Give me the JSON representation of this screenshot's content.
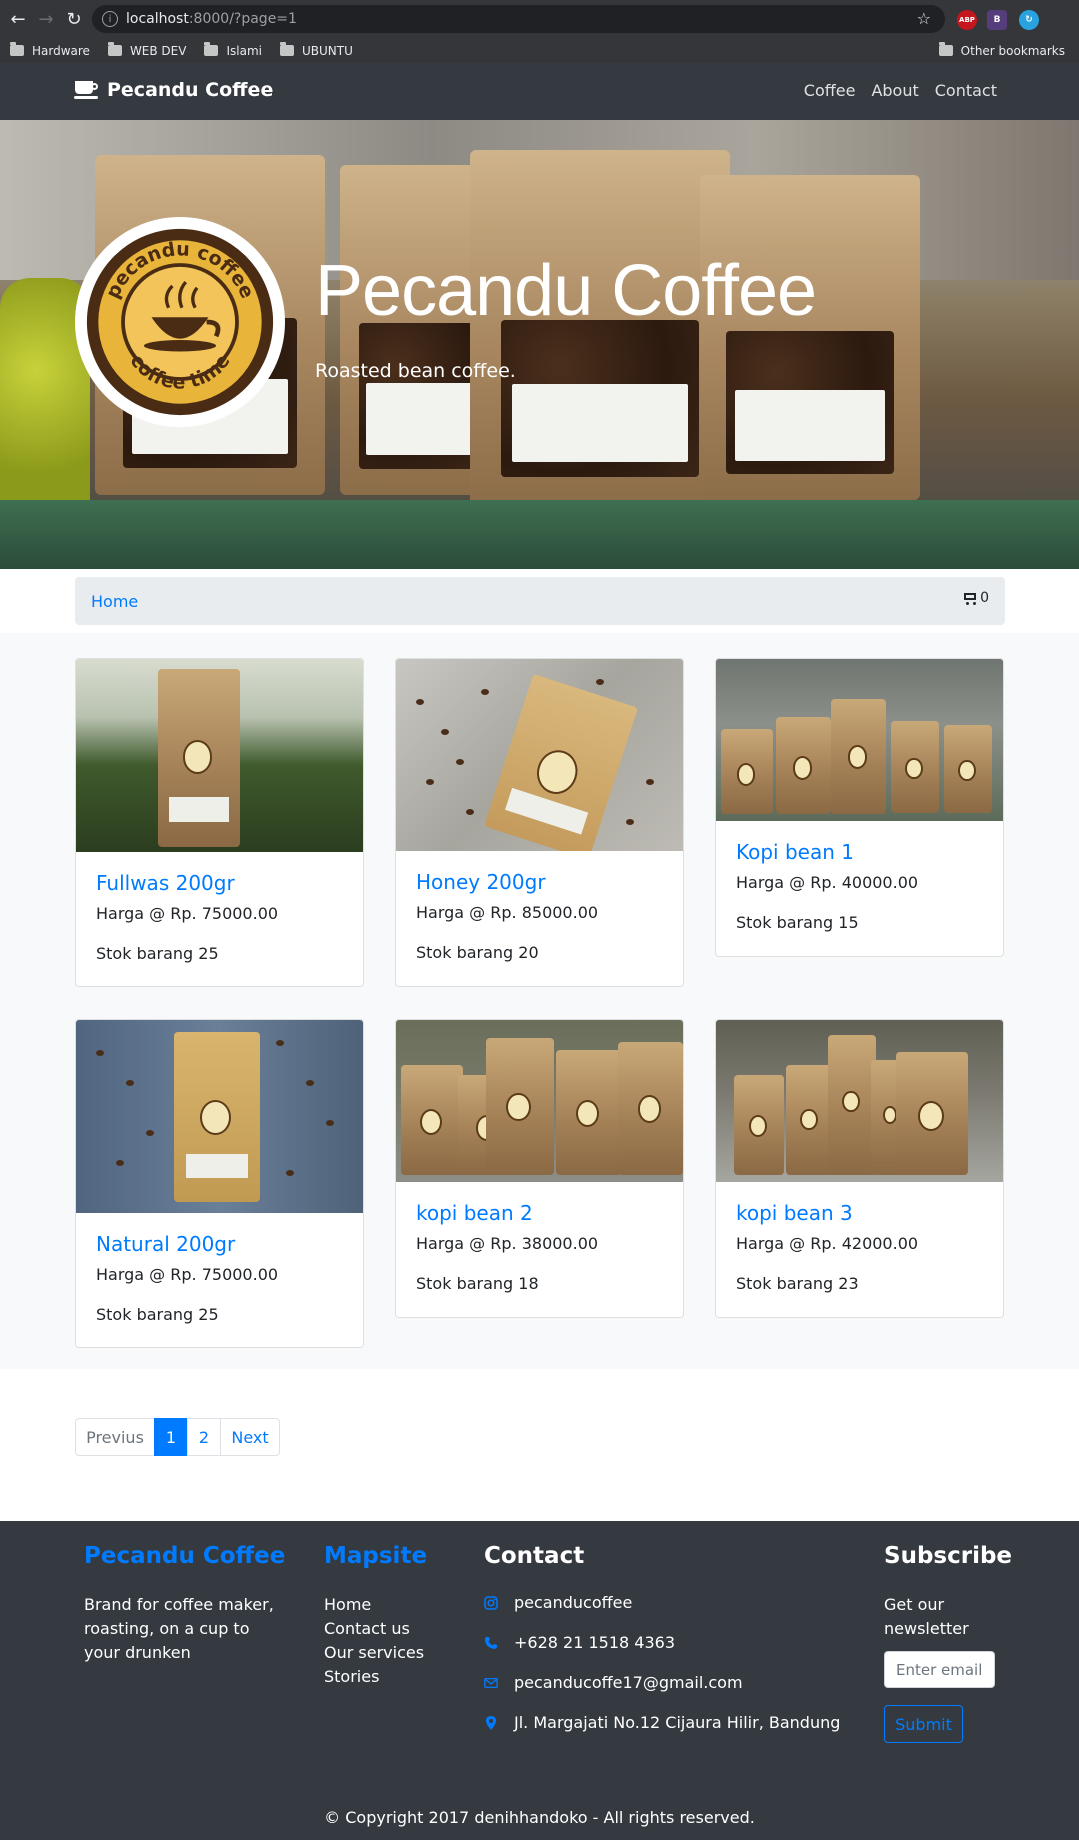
{
  "browser": {
    "url_host": "localhost",
    "url_path": ":8000/?page=1",
    "bookmarks": [
      "Hardware",
      "WEB DEV",
      "Islami",
      "UBUNTU"
    ],
    "other_bookmarks": "Other bookmarks",
    "ext_abp": "ABP",
    "ext_b": "B"
  },
  "navbar": {
    "brand": "Pecandu Coffee",
    "links": [
      "Coffee",
      "About",
      "Contact"
    ]
  },
  "hero": {
    "title": "Pecandu Coffee",
    "subtitle": "Roasted bean coffee.",
    "logo_top": "pecandu coffee",
    "logo_bottom": "coffee time"
  },
  "breadcrumb": {
    "home": "Home",
    "cart_count": "0"
  },
  "products": [
    {
      "name": "Fullwas 200gr",
      "price": "Harga @ Rp. 75000.00",
      "stock": "Stok barang 25"
    },
    {
      "name": "Honey 200gr",
      "price": "Harga @ Rp. 85000.00",
      "stock": "Stok barang 20"
    },
    {
      "name": "Kopi bean 1",
      "price": "Harga @ Rp. 40000.00",
      "stock": "Stok barang 15"
    },
    {
      "name": "Natural 200gr",
      "price": "Harga @ Rp. 75000.00",
      "stock": "Stok barang 25"
    },
    {
      "name": "kopi bean 2",
      "price": "Harga @ Rp. 38000.00",
      "stock": "Stok barang 18"
    },
    {
      "name": "kopi bean 3",
      "price": "Harga @ Rp. 42000.00",
      "stock": "Stok barang 23"
    }
  ],
  "pagination": {
    "prev": "Previus",
    "pages": [
      "1",
      "2"
    ],
    "active": "1",
    "next": "Next"
  },
  "footer": {
    "brand_title": "Pecandu Coffee",
    "brand_desc": "Brand for coffee maker, roasting, on a cup to your drunken",
    "mapsite_title": "Mapsite",
    "mapsite_links": [
      "Home",
      "Contact us",
      "Our services",
      "Stories"
    ],
    "contact_title": "Contact",
    "contact": {
      "instagram": "pecanducoffee",
      "phone": "+628 21 1518 4363",
      "email": "pecanducoffe17@gmail.com",
      "address": "Jl. Margajati No.12 Cijaura Hilir, Bandung"
    },
    "subscribe_title": "Subscribe",
    "subscribe_text": "Get our newsletter",
    "email_placeholder": "Enter email",
    "submit": "Submit",
    "copyright": "© Copyright 2017 denihhandoko - All rights reserved."
  },
  "colors": {
    "primary": "#007bff",
    "navbar": "#343a40",
    "breadcrumb_bg": "#e9ecef",
    "section_bg": "#f8f9fa"
  }
}
